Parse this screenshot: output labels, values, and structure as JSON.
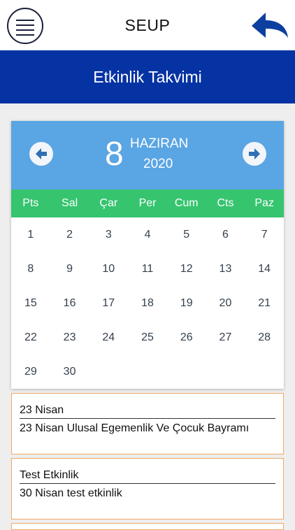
{
  "header": {
    "title": "SEUP",
    "menu_icon": "hamburger-menu-icon",
    "back_icon": "back-arrow-icon"
  },
  "banner": {
    "title": "Etkinlik Takvimi",
    "color": "#0633a3"
  },
  "calendar": {
    "day": "8",
    "month": "HAZIRAN",
    "year": "2020",
    "header_color": "#5aa5e3",
    "weekday_color": "#36c46f",
    "weekdays": [
      "Pts",
      "Sal",
      "Çar",
      "Per",
      "Cum",
      "Cts",
      "Paz"
    ],
    "weeks": [
      [
        "1",
        "2",
        "3",
        "4",
        "5",
        "6",
        "7"
      ],
      [
        "8",
        "9",
        "10",
        "11",
        "12",
        "13",
        "14"
      ],
      [
        "15",
        "16",
        "17",
        "18",
        "19",
        "20",
        "21"
      ],
      [
        "22",
        "23",
        "24",
        "25",
        "26",
        "27",
        "28"
      ],
      [
        "29",
        "30",
        "",
        "",
        "",
        "",
        ""
      ]
    ]
  },
  "events": [
    {
      "title": "23 Nisan",
      "description": "23 Nisan Ulusal Egemenlik Ve Çocuk Bayramı"
    },
    {
      "title": "Test Etkinlik",
      "description": "30 Nisan test etkinlik"
    }
  ]
}
